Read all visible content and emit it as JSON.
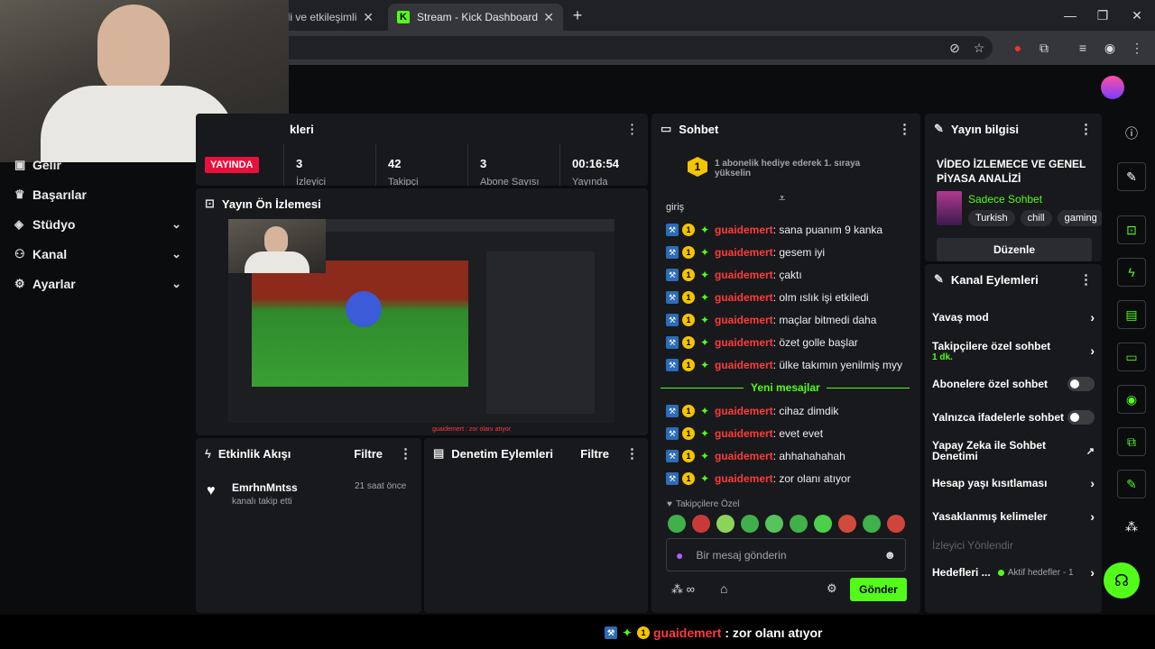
{
  "browser": {
    "tabs": [
      {
        "label": "celi ve etkileşimli"
      },
      {
        "label": "Stream - Kick Dashboard",
        "favicon": "K"
      }
    ],
    "new_tab": "+",
    "window_controls": {
      "minimize": "—",
      "maximize": "❐",
      "close": "✕"
    }
  },
  "sidebar": {
    "items": [
      {
        "label": "Gelir",
        "icon": "wallet-icon"
      },
      {
        "label": "Başarılar",
        "icon": "trophy-icon"
      },
      {
        "label": "Stüdyo",
        "icon": "studio-icon"
      },
      {
        "label": "Kanal",
        "icon": "users-icon"
      },
      {
        "label": "Ayarlar",
        "icon": "gear-icon"
      }
    ]
  },
  "stats": {
    "title": "kleri",
    "live_badge": "YAYINDA",
    "values": [
      "3",
      "42",
      "3",
      "00:16:54"
    ],
    "labels": [
      "İzleyici",
      "Takipçi",
      "Abone Sayısı",
      "Yayında"
    ]
  },
  "preview": {
    "title": "Yayın Ön İzlemesi",
    "caption": "guaidemert : zor olanı atıyor"
  },
  "activity": {
    "title": "Etkinlik Akışı",
    "filter": "Filtre",
    "events": [
      {
        "user": "EmrhnMntss",
        "action": "kanalı takip etti",
        "time": "21 saat önce"
      }
    ]
  },
  "moderation": {
    "title": "Denetim Eylemleri",
    "filter": "Filtre"
  },
  "chat": {
    "title": "Sohbet",
    "pinned": "1 abonelik hediye ederek 1. sıraya yükselin",
    "pinned_rank": "1",
    "partial": "giriş",
    "messages_old": [
      {
        "user": "guaidemert",
        "text": ": sana puanım 9 kanka"
      },
      {
        "user": "guaidemert",
        "text": ": gesem iyi"
      },
      {
        "user": "guaidemert",
        "text": ": çaktı"
      },
      {
        "user": "guaidemert",
        "text": ": olm ıslık işi etkiledi"
      },
      {
        "user": "guaidemert",
        "text": ": maçlar bitmedi daha"
      },
      {
        "user": "guaidemert",
        "text": ": özet golle başlar"
      },
      {
        "user": "guaidemert",
        "text": ": ülke takımın yenilmiş myy"
      }
    ],
    "new_divider": "Yeni mesajlar",
    "messages_new": [
      {
        "user": "guaidemert",
        "text": ": cihaz dimdik"
      },
      {
        "user": "guaidemert",
        "text": ": evet evet"
      },
      {
        "user": "guaidemert",
        "text": ": ahhahahahah"
      },
      {
        "user": "guaidemert",
        "text": ": zor olanı atıyor"
      }
    ],
    "followers_only": "Takipçilere Özel",
    "input_placeholder": "Bir mesaj gönderin",
    "send": "Gönder"
  },
  "stream_info": {
    "title": "Yayın bilgisi",
    "stream_title": "VİDEO İZLEMECE VE GENEL PİYASA ANALİZİ",
    "category": "Sadece Sohbet",
    "tags": [
      "Turkish",
      "chill",
      "gaming"
    ],
    "edit": "Düzenle"
  },
  "channel_actions": {
    "title": "Kanal Eylemleri",
    "slow_mode": "Yavaş mod",
    "followers_chat": "Takipçilere özel sohbet",
    "followers_chat_value": "1 dk.",
    "subs_chat": "Abonelere özel sohbet",
    "emotes_only": "Yalnızca ifadelerle sohbet",
    "ai_moderation": "Yapay Zeka ile Sohbet Denetimi",
    "age_restriction": "Hesap yaşı kısıtlaması",
    "banned_words": "Yasaklanmış kelimeler",
    "viewer_redirect": "İzleyici Yönlendir",
    "goals": "Hedefleri ...",
    "goals_status": "Aktif hedefler - 1"
  },
  "ticker": {
    "user": "guaidemert",
    "text": " : zor olanı atıyor"
  },
  "colors": {
    "accent": "#53fc18",
    "live": "#e9113c",
    "username": "#ff3b3b",
    "panel": "#18191c"
  }
}
